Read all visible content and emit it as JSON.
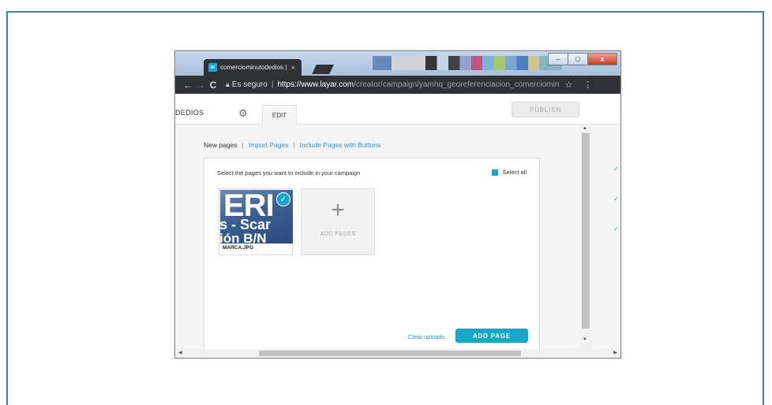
{
  "browser": {
    "tab_favicon": "or",
    "tab_title": "comerciominutodedios |",
    "tab_close": "×",
    "window_controls": [
      "–",
      "□",
      "x"
    ],
    "nav_back": "←",
    "nav_forward": "→",
    "reload": "C",
    "security_label": "Es seguro",
    "url_host": "https://www.layar.com",
    "url_path": "/creator/campaign/yamhq_georeferenciacion_comerciominut",
    "star": "☆",
    "menu": "⋮"
  },
  "app": {
    "brand_text": "DEDIOS",
    "edit_tab": "EDIT",
    "publish_label": "PUBLISH"
  },
  "subnav": {
    "new_pages": "New pages",
    "import_pages": "Import Pages",
    "include_buttons": "Include Pages with Buttons",
    "separator": "|"
  },
  "panel": {
    "title": "Select the pages you want to include in your campaign",
    "select_all": "Select all",
    "card": {
      "file_name": "MARCA.JPG",
      "thumb_line1": "ERI",
      "thumb_line2": "s - Scar",
      "thumb_line3": "ión B/N"
    },
    "add_pages_plus": "+",
    "add_pages_label": "ADD PAGES",
    "clear_uploads": "Clear uploads",
    "add_page_button": "ADD PAGE"
  },
  "colors": {
    "accent": "#19a6c9",
    "link": "#2a93c4",
    "chrome_dark": "#2f3136",
    "frame": "#3d8a8a"
  }
}
